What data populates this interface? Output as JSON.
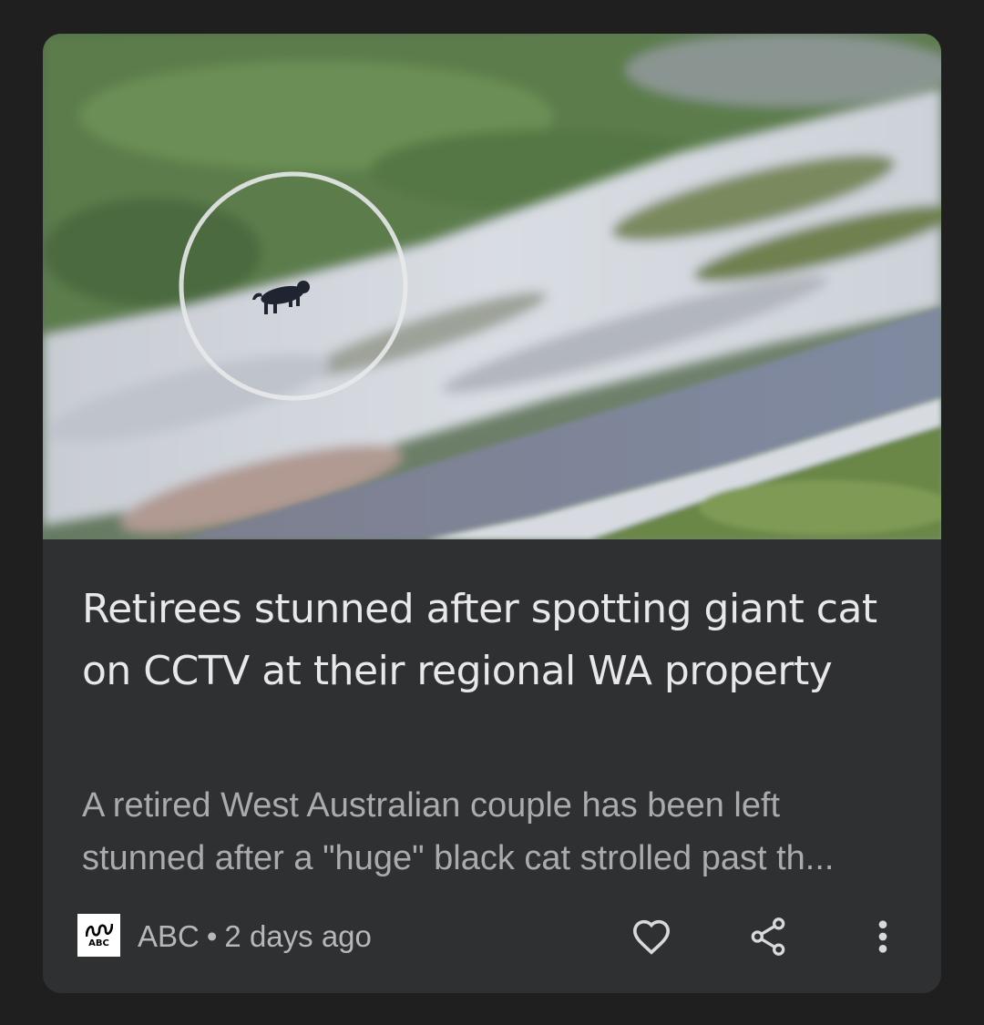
{
  "article": {
    "headline": "Retirees stunned after spotting giant cat on CCTV at their regional WA property",
    "snippet_line1": "A retired West Australian couple has been left",
    "snippet_line2": "stunned after a \"huge\" black cat strolled past th...",
    "publisher_logo_text": "ABC",
    "publisher": "ABC",
    "separator": "•",
    "age": "2 days ago"
  },
  "actions": {
    "like_icon": "heart-outline-icon",
    "share_icon": "share-icon",
    "more_icon": "more-vert-icon"
  },
  "colors": {
    "background": "#1f1f1f",
    "card": "#2f3032",
    "headline": "#e8e8ea",
    "snippet": "#a9abaf",
    "meta": "#b5b7bb"
  }
}
